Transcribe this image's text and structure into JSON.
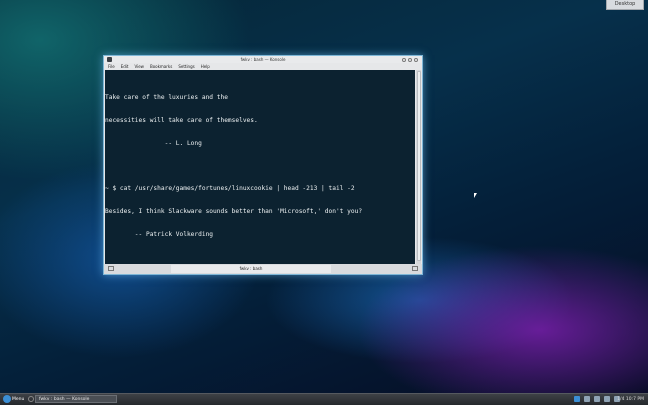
{
  "desktop": {
    "button_label": "Desktop"
  },
  "window": {
    "title": "fwkv : bash — Konsole",
    "menu": [
      "File",
      "Edit",
      "View",
      "Bookmarks",
      "Settings",
      "Help"
    ],
    "tab_label": "fwkv : bash"
  },
  "terminal": {
    "lines": [
      "Take care of the luxuries and the",
      "necessities will take care of themselves.",
      "                -- L. Long",
      "",
      "~ $ cat /usr/share/games/fortunes/linuxcookie | head -213 | tail -2",
      "Besides, I think Slackware sounds better than 'Microsoft,' don't you?",
      "        -- Patrick Volkerding",
      ""
    ],
    "prompt": "~ $ "
  },
  "taskbar": {
    "kicker_label": "Menu",
    "task_label": "fwkv : bash — Konsole",
    "clock": "1/4 10:7 PM"
  },
  "colors": {
    "terminal_bg": "#0c2230",
    "terminal_fg": "#eef2f3",
    "window_glow": "#7db6d6",
    "accent": "#3b8fd6"
  }
}
